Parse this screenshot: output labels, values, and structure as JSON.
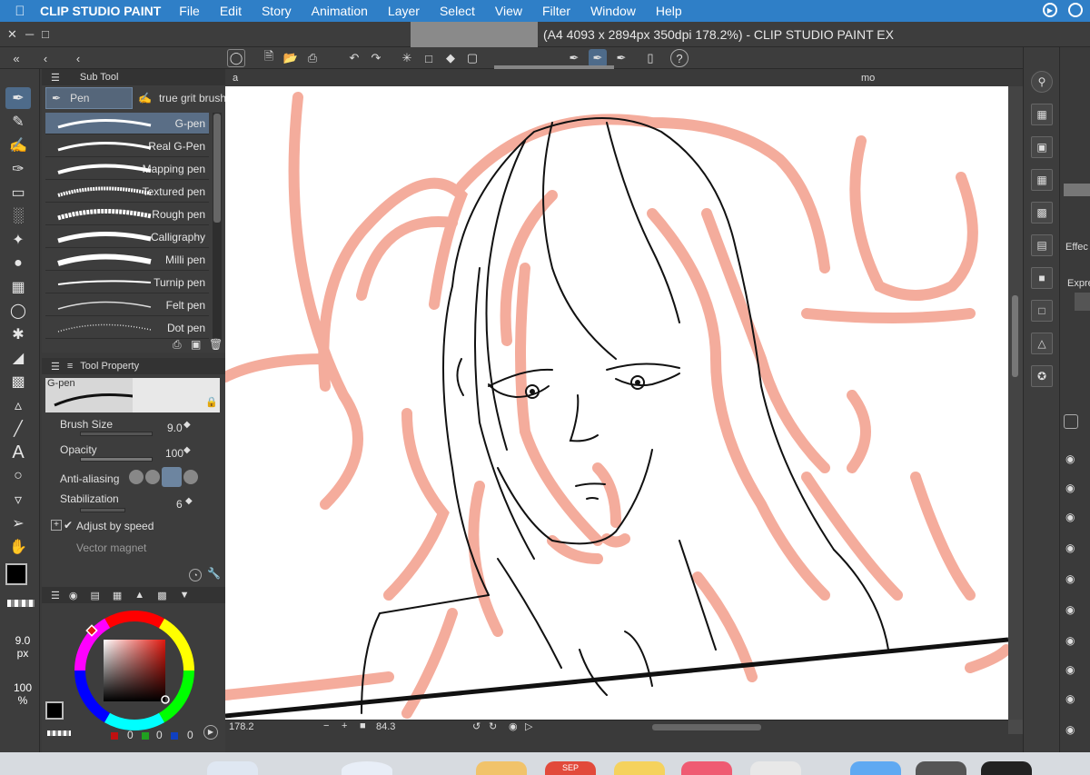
{
  "menubar": {
    "app_name": "CLIP STUDIO PAINT",
    "items": [
      "File",
      "Edit",
      "Story",
      "Animation",
      "Layer",
      "Select",
      "View",
      "Filter",
      "Window",
      "Help"
    ],
    "apple_icon": "apple-logo-icon"
  },
  "titlebar": {
    "title": "(A4 4093 x 2894px 350dpi 178.2%) - CLIP STUDIO PAINT EX"
  },
  "subtool": {
    "header": "Sub Tool",
    "tabs": [
      "Pen",
      "true grit brush"
    ],
    "brushes": [
      {
        "label": "G-pen",
        "selected": true
      },
      {
        "label": "Real G-Pen"
      },
      {
        "label": "Mapping pen"
      },
      {
        "label": "Textured pen"
      },
      {
        "label": "Rough pen"
      },
      {
        "label": "Calligraphy"
      },
      {
        "label": "Milli pen"
      },
      {
        "label": "Turnip pen"
      },
      {
        "label": "Felt pen"
      },
      {
        "label": "Dot pen"
      }
    ]
  },
  "toolprop": {
    "header": "Tool Property",
    "preset_name": "G-pen",
    "brush_size_label": "Brush Size",
    "brush_size_value": "9.0",
    "opacity_label": "Opacity",
    "opacity_value": "100",
    "antialias_label": "Anti-aliasing",
    "stabilization_label": "Stabilization",
    "stabilization_value": "6",
    "adjust_label": "Adjust by speed",
    "vector_label": "Vector magnet"
  },
  "colorpanel": {
    "size_indicator": "9.0",
    "size_unit": "px",
    "opacity_indicator": "100",
    "opacity_unit": "%",
    "rgb": [
      "0",
      "0",
      "0"
    ],
    "main_color": "#000000",
    "hue_marker_color": "#e0190f"
  },
  "canvas": {
    "tab_suffix": "mo",
    "tab_prefix": "a"
  },
  "statusbar": {
    "zoom": "178.2",
    "angle": "84.3"
  },
  "rightpanel": {
    "effect_label": "Effec",
    "expr_label": "Expre"
  },
  "dock": {
    "calendar_label": "SEP"
  }
}
